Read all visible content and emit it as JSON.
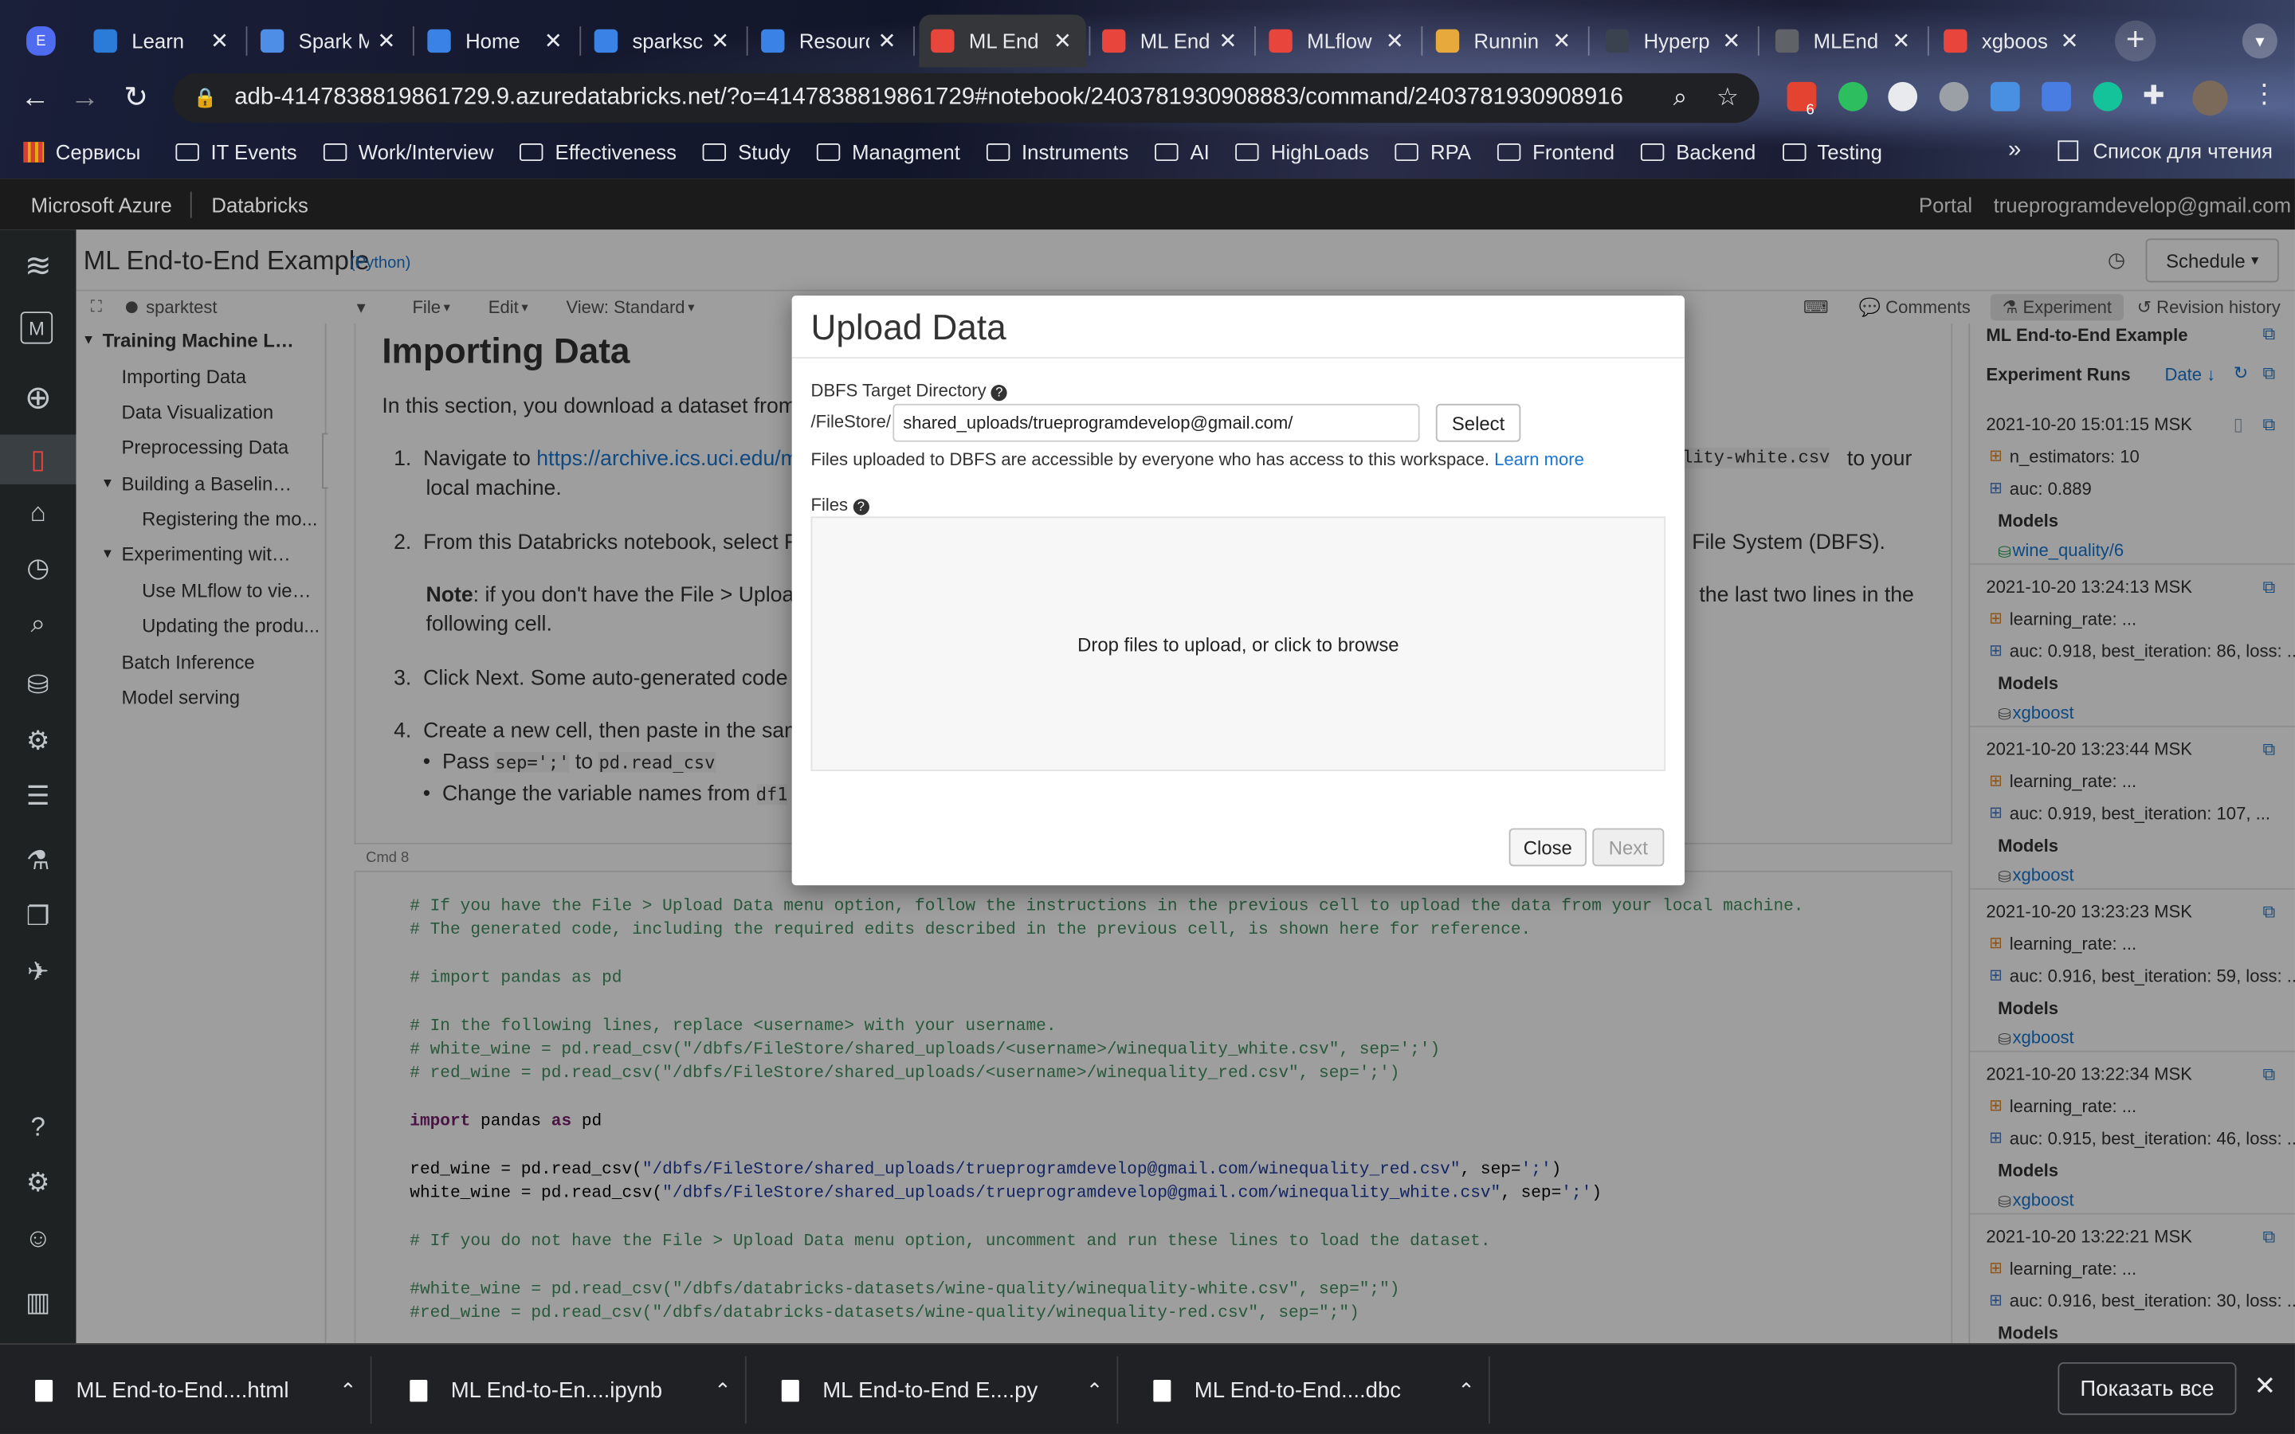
{
  "browser": {
    "tabs": [
      {
        "label": "E",
        "icon": "profile-icon",
        "color": "#4f6cf0"
      },
      {
        "label": "Learn",
        "icon": "learn-icon",
        "color": "#2b7bd8"
      },
      {
        "label": "Spark M",
        "icon": "spark-icon",
        "color": "#4e8ee6"
      },
      {
        "label": "Home",
        "icon": "azure-icon",
        "color": "#3b82e6"
      },
      {
        "label": "sparksc",
        "icon": "azure-icon",
        "color": "#3b82e6"
      },
      {
        "label": "Resourc",
        "icon": "azure-icon",
        "color": "#3b82e6"
      },
      {
        "label": "ML End",
        "icon": "databricks-icon",
        "color": "#e8453c"
      },
      {
        "label": "ML End",
        "icon": "databricks-icon",
        "color": "#e8453c"
      },
      {
        "label": "MLflow",
        "icon": "databricks-icon",
        "color": "#e8453c"
      },
      {
        "label": "Runnin",
        "icon": "runner-icon",
        "color": "#e8a93c"
      },
      {
        "label": "Hyperp",
        "icon": "tds-icon",
        "color": "#3a4250"
      },
      {
        "label": "MLEnd",
        "icon": "globe-icon",
        "color": "#5f6368"
      },
      {
        "label": "xgboos",
        "icon": "databricks-icon",
        "color": "#e8453c"
      }
    ],
    "url": "adb-4147838819861729.9.azuredatabricks.net/?o=4147838819861729#notebook/2403781930908883/command/2403781930908916",
    "extension_badge": "6",
    "bookmarks": [
      "Сервисы",
      "IT Events",
      "Work/Interview",
      "Effectiveness",
      "Study",
      "Managment",
      "Instruments",
      "AI",
      "HighLoads",
      "RPA",
      "Frontend",
      "Backend",
      "Testing"
    ],
    "bookmarks_more": "»",
    "reading_list": "Список для чтения"
  },
  "azure_bar": {
    "brand": "Microsoft Azure",
    "product": "Databricks",
    "portal": "Portal",
    "user": "trueprogramdevelop@gmail.com"
  },
  "notebook": {
    "title": "ML End-to-End Example",
    "language": "(Python)",
    "schedule_label": "Schedule",
    "cluster": "sparktest",
    "menu": {
      "file": "File",
      "edit": "Edit",
      "view": "View: Standard"
    },
    "right_tabs": {
      "comments": "Comments",
      "experiment": "Experiment",
      "revision": "Revision history"
    },
    "toc": [
      {
        "label": "Training Machine Learn...",
        "level": 0
      },
      {
        "label": "Importing Data",
        "level": 1
      },
      {
        "label": "Data Visualization",
        "level": 1
      },
      {
        "label": "Preprocessing Data",
        "level": 1
      },
      {
        "label": "Building a Baseline M...",
        "level": 1
      },
      {
        "label": "Registering the mo...",
        "level": 2
      },
      {
        "label": "Experimenting with a ...",
        "level": 1
      },
      {
        "label": "Use MLflow to view...",
        "level": 2
      },
      {
        "label": "Updating the produ...",
        "level": 2
      },
      {
        "label": "Batch Inference",
        "level": 1
      },
      {
        "label": "Model serving",
        "level": 1
      }
    ],
    "cell": {
      "heading": "Importing Data",
      "intro": "In this section, you download a dataset from",
      "step1_prefix": "Navigate to ",
      "step1_link": "https://archive.ics.uci.edu/ml/",
      "step1_code": "uality-white.csv",
      "step1_suffix": " to your",
      "step1_line2": "local machine.",
      "step2": "From this Databricks notebook, select File",
      "step2_suffix": "File System (DBFS).",
      "note_label": "Note",
      "note_text": ": if you don't have the File > Upload",
      "note_suffix": "the last two lines in the",
      "note_line2": "following cell.",
      "step3": "Click Next. Some auto-generated code to",
      "step4": "Create a new cell, then paste in the samp",
      "bullet1_prefix": "Pass ",
      "bullet1_code1": "sep=';'",
      "bullet1_mid": " to ",
      "bullet1_code2": "pd.read_csv",
      "bullet2_prefix": "Change the variable names from ",
      "bullet2_code": "df1"
    },
    "cmd_label": "Cmd 8",
    "code_lines": [
      {
        "t": "# If you have the File > Upload Data menu option, follow the instructions in the previous cell to upload the data from your local machine.",
        "k": "cmt"
      },
      {
        "t": "# The generated code, including the required edits described in the previous cell, is shown here for reference.",
        "k": "cmt"
      },
      {
        "t": "",
        "k": ""
      },
      {
        "t": "# import pandas as pd",
        "k": "cmt"
      },
      {
        "t": "",
        "k": ""
      },
      {
        "t": "# In the following lines, replace <username> with your username.",
        "k": "cmt"
      },
      {
        "t": "# white_wine = pd.read_csv(\"/dbfs/FileStore/shared_uploads/<username>/winequality_white.csv\", sep=';')",
        "k": "cmt"
      },
      {
        "t": "# red_wine = pd.read_csv(\"/dbfs/FileStore/shared_uploads/<username>/winequality_red.csv\", sep=';')",
        "k": "cmt"
      },
      {
        "t": "",
        "k": ""
      },
      {
        "t": "import pandas as pd",
        "k": "imp"
      },
      {
        "t": "",
        "k": ""
      },
      {
        "t": "red_wine = pd.read_csv(\"/dbfs/FileStore/shared_uploads/trueprogramdevelop@gmail.com/winequality_red.csv\", sep=';')",
        "k": "read"
      },
      {
        "t": "white_wine = pd.read_csv(\"/dbfs/FileStore/shared_uploads/trueprogramdevelop@gmail.com/winequality_white.csv\", sep=';')",
        "k": "read"
      },
      {
        "t": "",
        "k": ""
      },
      {
        "t": "# If you do not have the File > Upload Data menu option, uncomment and run these lines to load the dataset.",
        "k": "cmt"
      },
      {
        "t": "",
        "k": ""
      },
      {
        "t": "#white_wine = pd.read_csv(\"/dbfs/databricks-datasets/wine-quality/winequality-white.csv\", sep=\";\")",
        "k": "cmt"
      },
      {
        "t": "#red_wine = pd.read_csv(\"/dbfs/databricks-datasets/wine-quality/winequality-red.csv\", sep=\";\")",
        "k": "cmt"
      }
    ]
  },
  "experiment_panel": {
    "title": "ML End-to-End Example",
    "runs_label": "Experiment Runs",
    "sort_label": "Date",
    "models_label": "Models",
    "runs": [
      {
        "date": "2021-10-20 15:01:15 MSK",
        "param": "n_estimators: 10",
        "metric": "auc: 0.889",
        "model": "wine_quality/6"
      },
      {
        "date": "2021-10-20 13:24:13 MSK",
        "param": "learning_rate: ...",
        "metric": "auc: 0.918, best_iteration: 86, loss: ...",
        "model": "xgboost"
      },
      {
        "date": "2021-10-20 13:23:44 MSK",
        "param": "learning_rate: ...",
        "metric": "auc: 0.919, best_iteration: 107, ...",
        "model": "xgboost"
      },
      {
        "date": "2021-10-20 13:23:23 MSK",
        "param": "learning_rate: ...",
        "metric": "auc: 0.916, best_iteration: 59, loss: ...",
        "model": "xgboost"
      },
      {
        "date": "2021-10-20 13:22:34 MSK",
        "param": "learning_rate: ...",
        "metric": "auc: 0.915, best_iteration: 46, loss: ...",
        "model": "xgboost"
      },
      {
        "date": "2021-10-20 13:22:21 MSK",
        "param": "learning_rate: ...",
        "metric": "auc: 0.916, best_iteration: 30, loss: ...",
        "model": ""
      }
    ]
  },
  "modal": {
    "title": "Upload Data",
    "target_label": "DBFS Target Directory",
    "prefix": "/FileStore/",
    "target_value": "shared_uploads/trueprogramdevelop@gmail.com/",
    "select_label": "Select",
    "info": "Files uploaded to DBFS are accessible by everyone who has access to this workspace.",
    "learn_more": "Learn more",
    "files_label": "Files",
    "drop_text": "Drop files to upload, or click to browse",
    "close_label": "Close",
    "next_label": "Next"
  },
  "downloads": {
    "items": [
      "ML End-to-End....html",
      "ML End-to-En....ipynb",
      "ML End-to-End E....py",
      "ML End-to-End....dbc"
    ],
    "show_all": "Показать все"
  }
}
